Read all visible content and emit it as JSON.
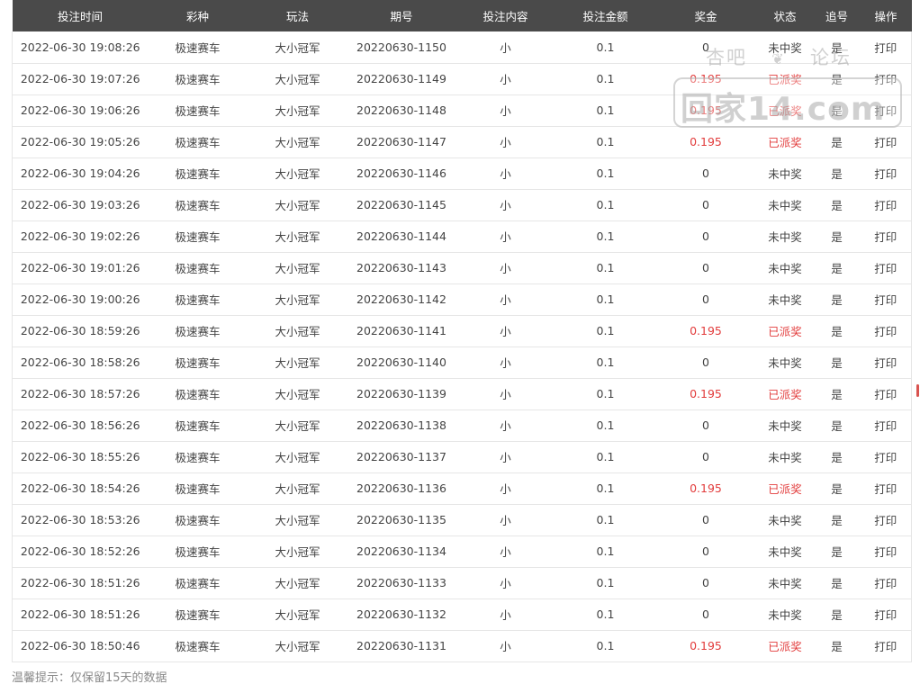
{
  "table": {
    "headers": [
      "投注时间",
      "彩种",
      "玩法",
      "期号",
      "投注内容",
      "投注金额",
      "奖金",
      "状态",
      "追号",
      "操作"
    ],
    "rows": [
      {
        "time": "2022-06-30 19:08:26",
        "lottery": "极速赛车",
        "play": "大小冠军",
        "issue": "20220630-1150",
        "content": "小",
        "amount": "0.1",
        "prize": "0",
        "status": "未中奖",
        "chase": "是",
        "action": "打印"
      },
      {
        "time": "2022-06-30 19:07:26",
        "lottery": "极速赛车",
        "play": "大小冠军",
        "issue": "20220630-1149",
        "content": "小",
        "amount": "0.1",
        "prize": "0.195",
        "status": "已派奖",
        "chase": "是",
        "action": "打印"
      },
      {
        "time": "2022-06-30 19:06:26",
        "lottery": "极速赛车",
        "play": "大小冠军",
        "issue": "20220630-1148",
        "content": "小",
        "amount": "0.1",
        "prize": "0.195",
        "status": "已派奖",
        "chase": "是",
        "action": "打印"
      },
      {
        "time": "2022-06-30 19:05:26",
        "lottery": "极速赛车",
        "play": "大小冠军",
        "issue": "20220630-1147",
        "content": "小",
        "amount": "0.1",
        "prize": "0.195",
        "status": "已派奖",
        "chase": "是",
        "action": "打印"
      },
      {
        "time": "2022-06-30 19:04:26",
        "lottery": "极速赛车",
        "play": "大小冠军",
        "issue": "20220630-1146",
        "content": "小",
        "amount": "0.1",
        "prize": "0",
        "status": "未中奖",
        "chase": "是",
        "action": "打印"
      },
      {
        "time": "2022-06-30 19:03:26",
        "lottery": "极速赛车",
        "play": "大小冠军",
        "issue": "20220630-1145",
        "content": "小",
        "amount": "0.1",
        "prize": "0",
        "status": "未中奖",
        "chase": "是",
        "action": "打印"
      },
      {
        "time": "2022-06-30 19:02:26",
        "lottery": "极速赛车",
        "play": "大小冠军",
        "issue": "20220630-1144",
        "content": "小",
        "amount": "0.1",
        "prize": "0",
        "status": "未中奖",
        "chase": "是",
        "action": "打印"
      },
      {
        "time": "2022-06-30 19:01:26",
        "lottery": "极速赛车",
        "play": "大小冠军",
        "issue": "20220630-1143",
        "content": "小",
        "amount": "0.1",
        "prize": "0",
        "status": "未中奖",
        "chase": "是",
        "action": "打印"
      },
      {
        "time": "2022-06-30 19:00:26",
        "lottery": "极速赛车",
        "play": "大小冠军",
        "issue": "20220630-1142",
        "content": "小",
        "amount": "0.1",
        "prize": "0",
        "status": "未中奖",
        "chase": "是",
        "action": "打印"
      },
      {
        "time": "2022-06-30 18:59:26",
        "lottery": "极速赛车",
        "play": "大小冠军",
        "issue": "20220630-1141",
        "content": "小",
        "amount": "0.1",
        "prize": "0.195",
        "status": "已派奖",
        "chase": "是",
        "action": "打印"
      },
      {
        "time": "2022-06-30 18:58:26",
        "lottery": "极速赛车",
        "play": "大小冠军",
        "issue": "20220630-1140",
        "content": "小",
        "amount": "0.1",
        "prize": "0",
        "status": "未中奖",
        "chase": "是",
        "action": "打印"
      },
      {
        "time": "2022-06-30 18:57:26",
        "lottery": "极速赛车",
        "play": "大小冠军",
        "issue": "20220630-1139",
        "content": "小",
        "amount": "0.1",
        "prize": "0.195",
        "status": "已派奖",
        "chase": "是",
        "action": "打印"
      },
      {
        "time": "2022-06-30 18:56:26",
        "lottery": "极速赛车",
        "play": "大小冠军",
        "issue": "20220630-1138",
        "content": "小",
        "amount": "0.1",
        "prize": "0",
        "status": "未中奖",
        "chase": "是",
        "action": "打印"
      },
      {
        "time": "2022-06-30 18:55:26",
        "lottery": "极速赛车",
        "play": "大小冠军",
        "issue": "20220630-1137",
        "content": "小",
        "amount": "0.1",
        "prize": "0",
        "status": "未中奖",
        "chase": "是",
        "action": "打印"
      },
      {
        "time": "2022-06-30 18:54:26",
        "lottery": "极速赛车",
        "play": "大小冠军",
        "issue": "20220630-1136",
        "content": "小",
        "amount": "0.1",
        "prize": "0.195",
        "status": "已派奖",
        "chase": "是",
        "action": "打印"
      },
      {
        "time": "2022-06-30 18:53:26",
        "lottery": "极速赛车",
        "play": "大小冠军",
        "issue": "20220630-1135",
        "content": "小",
        "amount": "0.1",
        "prize": "0",
        "status": "未中奖",
        "chase": "是",
        "action": "打印"
      },
      {
        "time": "2022-06-30 18:52:26",
        "lottery": "极速赛车",
        "play": "大小冠军",
        "issue": "20220630-1134",
        "content": "小",
        "amount": "0.1",
        "prize": "0",
        "status": "未中奖",
        "chase": "是",
        "action": "打印"
      },
      {
        "time": "2022-06-30 18:51:26",
        "lottery": "极速赛车",
        "play": "大小冠军",
        "issue": "20220630-1133",
        "content": "小",
        "amount": "0.1",
        "prize": "0",
        "status": "未中奖",
        "chase": "是",
        "action": "打印"
      },
      {
        "time": "2022-06-30 18:51:26",
        "lottery": "极速赛车",
        "play": "大小冠军",
        "issue": "20220630-1132",
        "content": "小",
        "amount": "0.1",
        "prize": "0",
        "status": "未中奖",
        "chase": "是",
        "action": "打印"
      },
      {
        "time": "2022-06-30 18:50:46",
        "lottery": "极速赛车",
        "play": "大小冠军",
        "issue": "20220630-1131",
        "content": "小",
        "amount": "0.1",
        "prize": "0.195",
        "status": "已派奖",
        "chase": "是",
        "action": "打印"
      }
    ]
  },
  "tip": "温馨提示：仅保留15天的数据",
  "watermark": {
    "line1_left": "杏吧",
    "line1_right": "论坛",
    "big_text": "回家14.com"
  },
  "colors": {
    "header_bg": "#4a4a4a",
    "win_red": "#e23c3c",
    "text": "#444444"
  }
}
